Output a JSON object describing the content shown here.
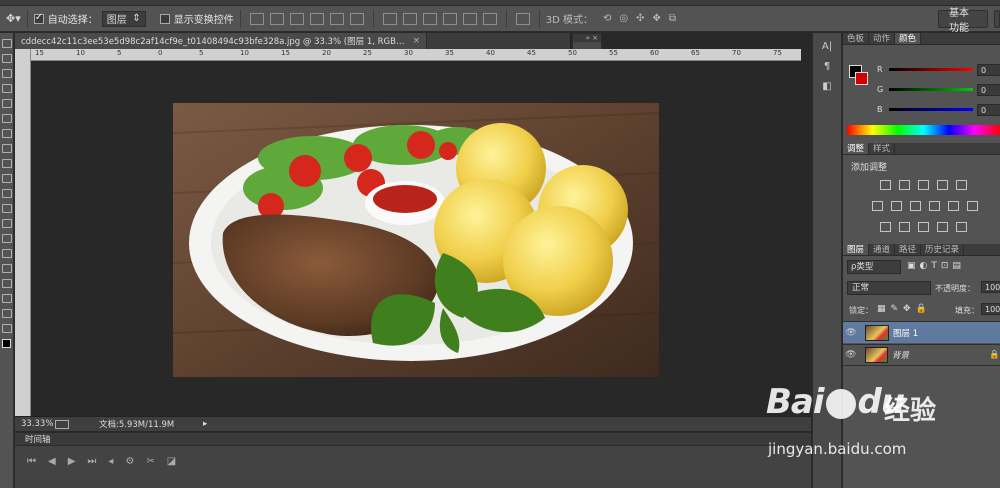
{
  "options_bar": {
    "auto_select_label": "自动选择：",
    "auto_select_value": "图层",
    "show_transform_label": "显示变换控件",
    "mode_3d_label": "3D 模式：",
    "workspace_button": "基本功能"
  },
  "document": {
    "tab_title": "cddecc42c11c3ee53e5d98c2af14cf9e_t01408494c93bfe328a.jpg @ 33.3% (图层 1, RGB/8#) *",
    "close_glyph": "×",
    "ruler_ticks": [
      "15",
      "10",
      "5",
      "0",
      "5",
      "10",
      "15",
      "20",
      "25",
      "30",
      "35",
      "40",
      "45",
      "50",
      "55",
      "60",
      "65",
      "70",
      "75"
    ]
  },
  "status_bar": {
    "zoom": "33.33%",
    "doc_info": "文档:5.93M/11.9M"
  },
  "timeline": {
    "title": "时间轴"
  },
  "color_panel": {
    "tabs": [
      "色板",
      "动作",
      "颜色"
    ],
    "active_tab": "颜色",
    "r_label": "R",
    "g_label": "G",
    "b_label": "B",
    "r_value": "0",
    "g_value": "0",
    "b_value": "0"
  },
  "adjust_panel": {
    "tabs": [
      "调整",
      "样式"
    ],
    "title": "添加调整"
  },
  "layers_panel": {
    "tabs": [
      "图层",
      "通道",
      "路径",
      "历史记录"
    ],
    "filter_label": "ρ类型",
    "blend_mode": "正常",
    "opacity_label": "不透明度：",
    "opacity_value": "100",
    "lock_label": "锁定：",
    "fill_label": "填充：",
    "fill_value": "100",
    "layers": [
      {
        "name": "图层 1",
        "selected": true
      },
      {
        "name": "背景",
        "selected": false
      }
    ]
  },
  "watermark": {
    "brand": "Bai",
    "brand2": "du",
    "cn": "经验",
    "url": "jingyan.baidu.com"
  },
  "colors": {
    "accent_selected": "#5f7a9e",
    "panel_bg": "#535353"
  }
}
